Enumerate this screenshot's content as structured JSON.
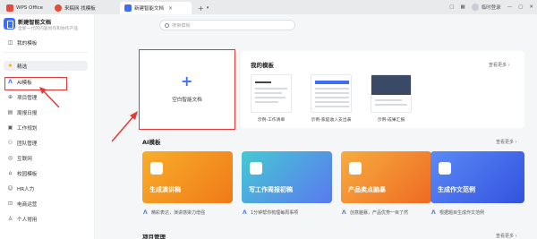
{
  "tabs": [
    {
      "label": "WPS Office",
      "color": "#e64a3b"
    },
    {
      "label": "来稿网 找模板",
      "color": "#e64a3b"
    },
    {
      "label": "新建智能文档",
      "color": "#3f6df3"
    }
  ],
  "new_tab_symbol": "+",
  "toolbar": {
    "login": "临时登录"
  },
  "brand": {
    "title": "新建智能文档",
    "subtitle": "全新一代的内容创作和协作产品"
  },
  "search": {
    "placeholder": "搜索模板"
  },
  "nav": [
    {
      "label": "我的模板",
      "icon": "template-icon"
    },
    {
      "label": "精选",
      "icon": "star-icon"
    },
    {
      "label": "AI模板",
      "icon": "ai-icon"
    },
    {
      "label": "项目管理",
      "icon": "project-icon"
    },
    {
      "label": "周报日报",
      "icon": "report-icon"
    },
    {
      "label": "工作规划",
      "icon": "plan-icon"
    },
    {
      "label": "团队管理",
      "icon": "team-icon"
    },
    {
      "label": "互联网",
      "icon": "internet-icon"
    },
    {
      "label": "校园模板",
      "icon": "campus-icon"
    },
    {
      "label": "HR人力",
      "icon": "hr-icon"
    },
    {
      "label": "电商运营",
      "icon": "ecommerce-icon"
    },
    {
      "label": "个人常用",
      "icon": "personal-icon"
    }
  ],
  "blank_card": {
    "label": "空白智能文档"
  },
  "my_templates": {
    "title": "我的模板",
    "more": "查看更多 ›",
    "items": [
      {
        "label": "示例-工作清单"
      },
      {
        "label": "示例-家庭收入支出表"
      },
      {
        "label": "示例-成果汇报"
      }
    ]
  },
  "ai_templates": {
    "title": "AI模板",
    "more": "查看更多 ›",
    "cards": [
      {
        "title": "生成演讲稿",
        "desc": "精彩表达，演讲感染力增强",
        "color_from": "#f7a21b",
        "color_to": "#f07a17"
      },
      {
        "title": "写工作周报初稿",
        "desc": "1分钟帮你梳理每周事项",
        "color_from": "#3dc6d0",
        "color_to": "#5a7cf0"
      },
      {
        "title": "产品卖点脑暴",
        "desc": "创意脑暴，产品优势一目了然",
        "color_from": "#f6a53a",
        "color_to": "#ef6c23"
      },
      {
        "title": "生成作文范例",
        "desc": "根据题目生成作文范例",
        "color_from": "#5a86f5",
        "color_to": "#3556e0"
      }
    ]
  },
  "bottom_section": {
    "title": "项目管理",
    "more": "查看更多 ›"
  },
  "colors": {
    "accent": "#3f6df3",
    "highlight": "#e53935"
  }
}
